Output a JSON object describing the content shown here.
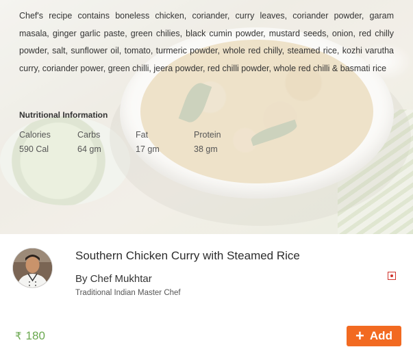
{
  "recipe": {
    "description": "Chef's recipe contains boneless chicken, coriander, curry leaves, coriander powder, garam masala, ginger garlic paste, green chilies, black cumin powder, mustard seeds, onion, red chilly powder, salt, sunflower oil, tomato, turmeric powder, whole red chilly, steamed rice, kozhi varutha curry, coriander power, green chilli, jeera powder, red chilli powder, whole red chilli & basmati rice",
    "nutrition_title": "Nutritional Information",
    "nutrients": [
      {
        "label": "Calories",
        "value": "590 Cal"
      },
      {
        "label": "Carbs",
        "value": "64 gm"
      },
      {
        "label": "Fat",
        "value": "17 gm"
      },
      {
        "label": "Protein",
        "value": "38 gm"
      }
    ]
  },
  "dish": {
    "title": "Southern Chicken Curry with Steamed Rice",
    "chef_name": "By Chef Mukhtar",
    "chef_title": "Traditional Indian Master Chef",
    "diet_icon": "non-veg-indicator-icon"
  },
  "order": {
    "currency_symbol": "₹",
    "price": "180",
    "add_label": "Add",
    "add_icon": "plus-icon"
  },
  "colors": {
    "accent": "#f26a21",
    "price": "#6aa84f",
    "nonveg": "#d0322b"
  }
}
